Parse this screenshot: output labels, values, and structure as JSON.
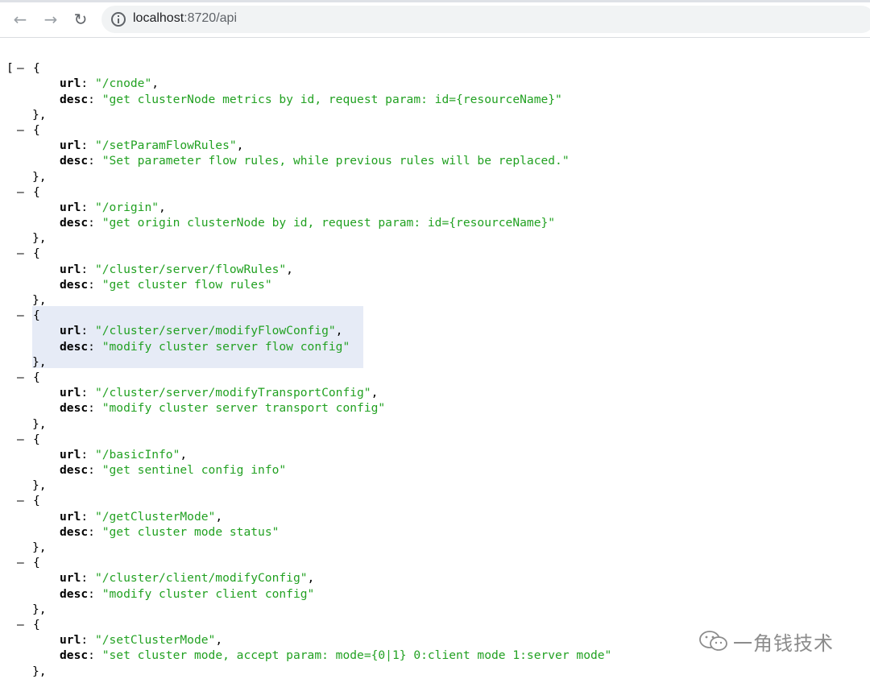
{
  "browser": {
    "url_host": "localhost",
    "url_path": ":8720/api",
    "back_icon": "←",
    "forward_icon": "→",
    "reload_icon": "↻"
  },
  "json": {
    "open_bracket": "[",
    "toggle": "–",
    "open_brace": "{",
    "close_brace": "},",
    "url_key": "url",
    "desc_key": "desc",
    "items": [
      {
        "url": "\"/cnode\"",
        "desc": "\"get clusterNode metrics by id, request param: id={resourceName}\""
      },
      {
        "url": "\"/setParamFlowRules\"",
        "desc": "\"Set parameter flow rules, while previous rules will be replaced.\""
      },
      {
        "url": "\"/origin\"",
        "desc": "\"get origin clusterNode by id, request param: id={resourceName}\""
      },
      {
        "url": "\"/cluster/server/flowRules\"",
        "desc": "\"get cluster flow rules\""
      },
      {
        "url": "\"/cluster/server/modifyFlowConfig\"",
        "desc": "\"modify cluster server flow config\""
      },
      {
        "url": "\"/cluster/server/modifyTransportConfig\"",
        "desc": "\"modify cluster server transport config\""
      },
      {
        "url": "\"/basicInfo\"",
        "desc": "\"get sentinel config info\""
      },
      {
        "url": "\"/getClusterMode\"",
        "desc": "\"get cluster mode status\""
      },
      {
        "url": "\"/cluster/client/modifyConfig\"",
        "desc": "\"modify cluster client config\""
      },
      {
        "url": "\"/setClusterMode\"",
        "desc": "\"set cluster mode, accept param: mode={0|1} 0:client mode 1:server mode\""
      }
    ]
  },
  "watermark": {
    "text": "一角钱技术",
    "icon": "wechat-icon"
  },
  "colors": {
    "string": "#22a122",
    "highlight": "#e6ebf6"
  }
}
